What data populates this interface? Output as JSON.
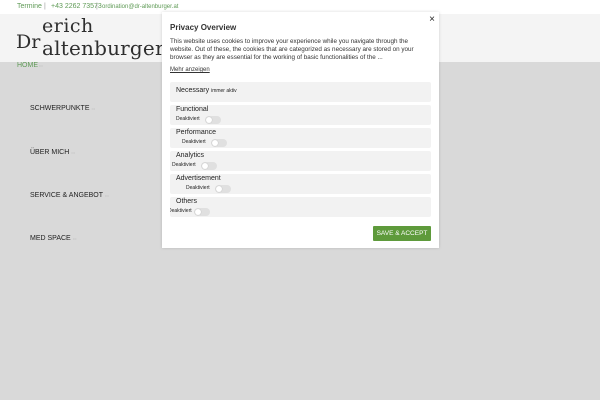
{
  "topbar": {
    "termine": "Termine",
    "separator1": "|",
    "phone": "+43 2262 73573",
    "separator2": "|",
    "email": "ordination@dr-altenburger.at"
  },
  "logo": {
    "prefix": "Dr",
    "first_name": "erich",
    "last_name": "altenburger"
  },
  "nav": {
    "home": "HOME",
    "items": [
      "SCHWERPUNKTE",
      "ÜBER MICH",
      "SERVICE & ANGEBOT",
      "MED SPACE"
    ]
  },
  "modal": {
    "title": "Privacy Overview",
    "close": "×",
    "description": "This website uses cookies to improve your experience while you navigate through the website. Out of these, the cookies that are categorized as necessary are stored on your browser as they are essential for the working of basic functionalities of the ...",
    "more_link": "Mehr anzeigen",
    "categories": [
      {
        "name": "Necessary",
        "note": "immer aktiv"
      },
      {
        "name": "Functional",
        "state": "Deaktiviert"
      },
      {
        "name": "Performance",
        "state": "Deaktiviert"
      },
      {
        "name": "Analytics",
        "state": "Deaktiviert"
      },
      {
        "name": "Advertisement",
        "state": "Deaktiviert"
      },
      {
        "name": "Others",
        "state": "Deaktiviert"
      }
    ],
    "save_button": "SAVE & ACCEPT"
  },
  "colors": {
    "accent": "#5e9a55",
    "button": "#5e9a3b",
    "overlay": "#d9d9d9"
  }
}
